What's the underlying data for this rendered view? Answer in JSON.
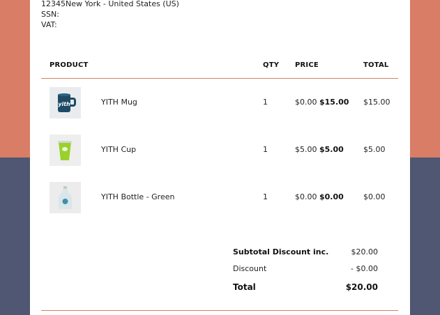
{
  "address": {
    "line1": "12345New York - United States (US)",
    "ssn_label": "SSN:",
    "vat_label": "VAT:"
  },
  "table": {
    "headers": {
      "product": "PRODUCT",
      "qty": "QTY",
      "price": "PRICE",
      "total": "TOTAL"
    },
    "rows": [
      {
        "name": "YITH Mug",
        "qty": "1",
        "price_regular": "$0.00",
        "price_sale": "$15.00",
        "total": "$15.00",
        "thumb_icon": "mug-image"
      },
      {
        "name": "YITH Cup",
        "qty": "1",
        "price_regular": "$5.00",
        "price_sale": "$5.00",
        "total": "$5.00",
        "thumb_icon": "cup-image"
      },
      {
        "name": "YITH Bottle - Green",
        "qty": "1",
        "price_regular": "$0.00",
        "price_sale": "$0.00",
        "total": "$0.00",
        "thumb_icon": "bottle-image"
      }
    ]
  },
  "summary": {
    "subtotal_label": "Subtotal Discount inc.",
    "subtotal_value": "$20.00",
    "discount_label": "Discount",
    "discount_value": "- $0.00",
    "total_label": "Total",
    "total_value": "$20.00"
  },
  "colors": {
    "accent": "#d97d66",
    "dark_band": "#4f5772",
    "paper": "#ffffff"
  }
}
